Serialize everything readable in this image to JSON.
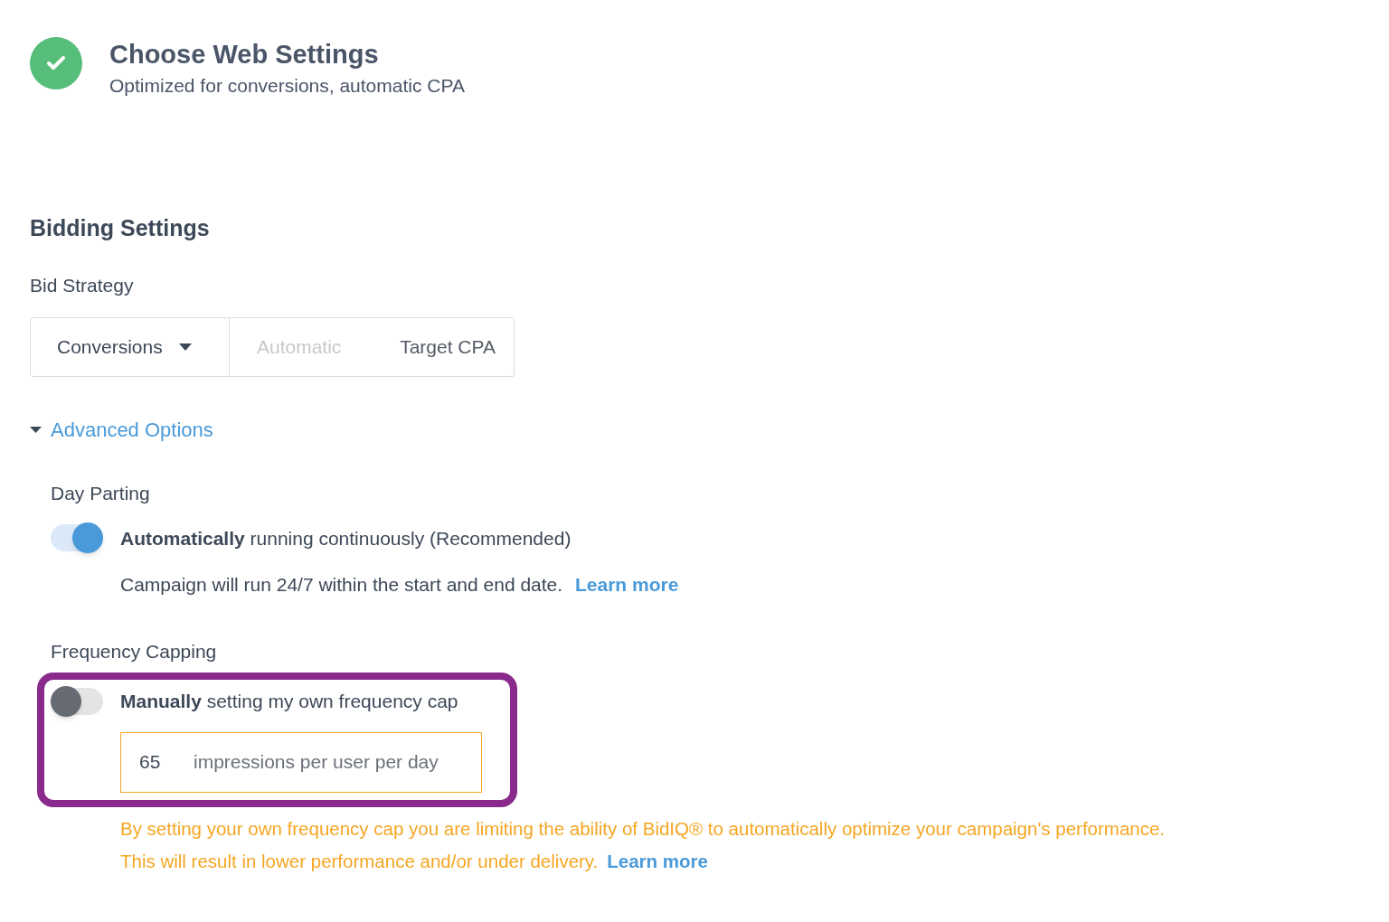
{
  "header": {
    "title": "Choose Web Settings",
    "subtitle": "Optimized for conversions, automatic CPA",
    "complete": true
  },
  "bidding": {
    "title": "Bidding Settings",
    "strategy_label": "Bid Strategy",
    "strategy_select": {
      "value": "Conversions"
    },
    "modes": [
      {
        "label": "Automatic",
        "disabled": true
      },
      {
        "label": "Target CPA",
        "disabled": false
      }
    ]
  },
  "advanced": {
    "label": "Advanced Options",
    "expanded": true
  },
  "day_parting": {
    "label": "Day Parting",
    "on": true,
    "text": "**Automatically** running continuously (Recommended)",
    "note": "Campaign will run 24/7 within the start and end date.",
    "link": "Learn more"
  },
  "frequency": {
    "label": "Frequency Capping",
    "on": false,
    "highlighted": true,
    "text": "**Manually** setting my own frequency cap",
    "value": "65",
    "unit": "impressions per user per day",
    "warning_lines": [
      "By setting your own frequency cap you are limiting the ability of BidIQ® to automatically optimize your campaign's performance.",
      "This will result in lower performance and/or under delivery."
    ],
    "link": "Learn more"
  }
}
